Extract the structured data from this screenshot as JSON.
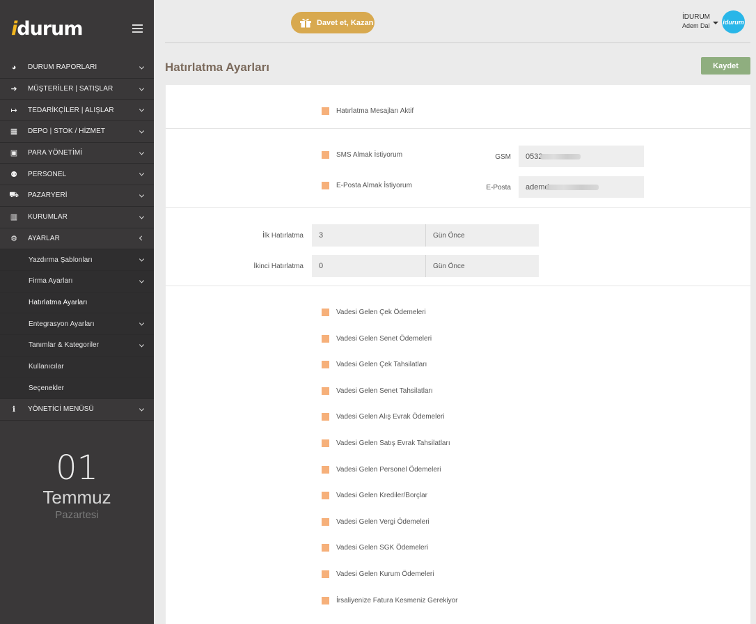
{
  "brand": {
    "logo_i": "i",
    "logo_rest": "durum"
  },
  "sidebar": {
    "items": [
      {
        "label": "DURUM RAPORLARI",
        "icon": "pie-chart-icon",
        "glyph": "◕",
        "expand": "down"
      },
      {
        "label": "MÜŞTERİLER | SATIŞLAR",
        "icon": "sign-in-icon",
        "glyph": "➜",
        "expand": "down"
      },
      {
        "label": "TEDARİKÇİLER | ALIŞLAR",
        "icon": "sign-out-icon",
        "glyph": "↦",
        "expand": "down"
      },
      {
        "label": "DEPO | STOK / HİZMET",
        "icon": "boxes-icon",
        "glyph": "▦",
        "expand": "down"
      },
      {
        "label": "PARA YÖNETİMİ",
        "icon": "money-icon",
        "glyph": "▣",
        "expand": "down"
      },
      {
        "label": "PERSONEL",
        "icon": "users-icon",
        "glyph": "⚉",
        "expand": "down"
      },
      {
        "label": "PAZARYERİ",
        "icon": "cart-icon",
        "glyph": "⛟",
        "expand": "down"
      },
      {
        "label": "KURUMLAR",
        "icon": "building-icon",
        "glyph": "▥",
        "expand": "down"
      },
      {
        "label": "AYARLAR",
        "icon": "cogs-icon",
        "glyph": "⚙",
        "expand": "left"
      }
    ],
    "sub_items": [
      {
        "label": "Yazdırma Şablonları",
        "expand": "down"
      },
      {
        "label": "Firma Ayarları",
        "expand": "down"
      },
      {
        "label": "Hatırlatma Ayarları",
        "expand": "none",
        "active": true
      },
      {
        "label": "Entegrasyon Ayarları",
        "expand": "down"
      },
      {
        "label": "Tanımlar & Kategoriler",
        "expand": "down"
      },
      {
        "label": "Kullanıcılar",
        "expand": "none"
      },
      {
        "label": "Seçenekler",
        "expand": "none"
      }
    ],
    "admin_item": {
      "label": "YÖNETİCİ MENÜSÜ",
      "icon": "info-icon",
      "glyph": "ℹ"
    }
  },
  "date_widget": {
    "day": "01",
    "month": "Temmuz",
    "weekday": "Pazartesi"
  },
  "header": {
    "invite_label": "Davet et, Kazan",
    "user_company": "İDURUM",
    "user_name": "Adem Dal",
    "avatar_text": "idurum"
  },
  "page": {
    "title": "Hatırlatma Ayarları",
    "save_label": "Kaydet"
  },
  "form": {
    "reminder_active_label": "Hatırlatma Mesajları Aktif",
    "sms_label": "SMS Almak İstiyorum",
    "email_label": "E-Posta Almak İstiyorum",
    "gsm_label": "GSM",
    "gsm_value": "0532",
    "eposta_label": "E-Posta",
    "eposta_value": "ademd",
    "first_reminder_label": "İlk Hatırlatma",
    "first_reminder_value": "3",
    "second_reminder_label": "İkinci Hatırlatma",
    "second_reminder_value": "0",
    "days_before_label": "Gün Önce",
    "reminders": [
      "Vadesi Gelen Çek Ödemeleri",
      "Vadesi Gelen Senet Ödemeleri",
      "Vadesi Gelen Çek Tahsilatları",
      "Vadesi Gelen Senet Tahsilatları",
      "Vadesi Gelen Alış Evrak Ödemeleri",
      "Vadesi Gelen Satış Evrak Tahsilatları",
      "Vadesi Gelen Personel Ödemeleri",
      "Vadesi Gelen Krediler/Borçlar",
      "Vadesi Gelen Vergi Ödemeleri",
      "Vadesi Gelen SGK Ödemeleri",
      "Vadesi Gelen Kurum Ödemeleri",
      "İrsaliyenize Fatura Kesmeniz Gerekiyor"
    ]
  },
  "colors": {
    "accent_orange": "#f6b07a",
    "save_green": "#8fae7f",
    "invite_gold": "#d8a94f",
    "sidebar_bg": "#3a3839",
    "logo_yellow": "#f2b61f",
    "avatar_blue": "#29b6e8"
  }
}
